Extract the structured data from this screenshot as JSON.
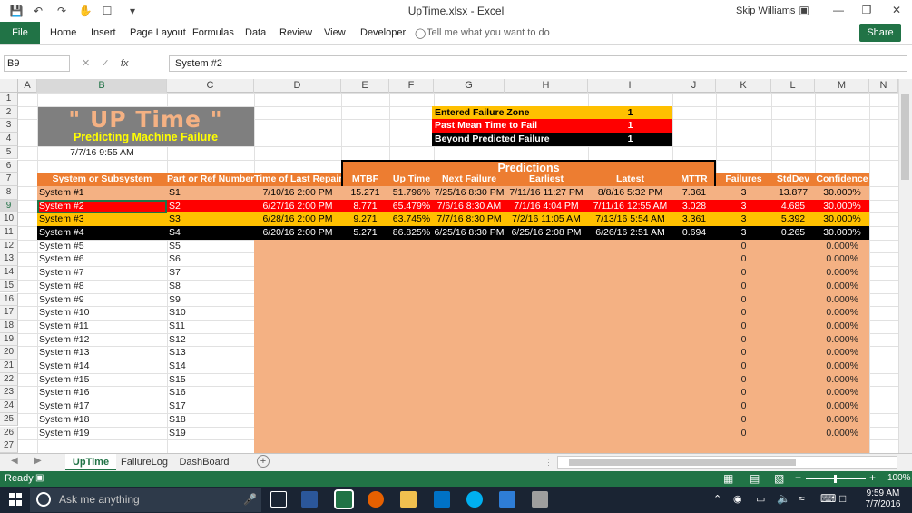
{
  "window": {
    "title": "UpTime.xlsx - Excel",
    "user": "Skip Williams"
  },
  "ribbon": {
    "file": "File",
    "tabs": [
      "Home",
      "Insert",
      "Page Layout",
      "Formulas",
      "Data",
      "Review",
      "View",
      "Developer"
    ],
    "tell_me": "Tell me what you want to do",
    "share": "Share"
  },
  "formula_bar": {
    "name_box": "B9",
    "formula": "System #2"
  },
  "columns": [
    "A",
    "B",
    "C",
    "D",
    "E",
    "F",
    "G",
    "H",
    "I",
    "J",
    "K",
    "L",
    "M",
    "N"
  ],
  "rows": [
    "1",
    "2",
    "3",
    "4",
    "5",
    "6",
    "7",
    "8",
    "9",
    "10",
    "11",
    "12",
    "13",
    "14",
    "15",
    "16",
    "17",
    "18",
    "19",
    "20",
    "21",
    "22",
    "23",
    "24",
    "25",
    "26",
    "27"
  ],
  "banner": {
    "title": "\" UP Time \"",
    "subtitle": "Predicting Machine Failure"
  },
  "date_cell": "7/7/16 9:55 AM",
  "legend": [
    {
      "label": "Entered Failure Zone",
      "value": "1",
      "color": "#ffc000"
    },
    {
      "label": "Past Mean Time to Fail",
      "value": "1",
      "color": "#ff0000"
    },
    {
      "label": "Beyond Predicted Failure",
      "value": "1",
      "color": "#000000"
    }
  ],
  "predictions_header": "Predictions",
  "headers": [
    "System or Subsystem",
    "Part or Ref  Number",
    "Time of Last Repair",
    "MTBF",
    "Up Time",
    "Next Failure",
    "Earliest",
    "Latest",
    "MTTR",
    "Failures",
    "StdDev",
    "Confidence"
  ],
  "data_rows": [
    {
      "system": "System #1",
      "part": "S1",
      "last": "7/10/16 2:00 PM",
      "mtbf": "15.271",
      "uptime": "51.796%",
      "next": "7/25/16 8:30 PM",
      "earliest": "7/11/16 11:27 PM",
      "latest": "8/8/16 5:32 PM",
      "mttr": "7.361",
      "failures": "3",
      "stddev": "13.877",
      "conf": "30.000%",
      "bg": "#f4b183",
      "fg": "#000000"
    },
    {
      "system": "System #2",
      "part": "S2",
      "last": "6/27/16 2:00 PM",
      "mtbf": "8.771",
      "uptime": "65.479%",
      "next": "7/6/16 8:30 AM",
      "earliest": "7/1/16 4:04 PM",
      "latest": "7/11/16 12:55 AM",
      "mttr": "3.028",
      "failures": "3",
      "stddev": "4.685",
      "conf": "30.000%",
      "bg": "#ff0000",
      "fg": "#ffffff"
    },
    {
      "system": "System #3",
      "part": "S3",
      "last": "6/28/16 2:00 PM",
      "mtbf": "9.271",
      "uptime": "63.745%",
      "next": "7/7/16 8:30 PM",
      "earliest": "7/2/16 11:05 AM",
      "latest": "7/13/16 5:54 AM",
      "mttr": "3.361",
      "failures": "3",
      "stddev": "5.392",
      "conf": "30.000%",
      "bg": "#ffc000",
      "fg": "#000000"
    },
    {
      "system": "System #4",
      "part": "S4",
      "last": "6/20/16 2:00 PM",
      "mtbf": "5.271",
      "uptime": "86.825%",
      "next": "6/25/16 8:30 PM",
      "earliest": "6/25/16 2:08 PM",
      "latest": "6/26/16 2:51 AM",
      "mttr": "0.694",
      "failures": "3",
      "stddev": "0.265",
      "conf": "30.000%",
      "bg": "#000000",
      "fg": "#ffffff"
    }
  ],
  "empty_rows": [
    {
      "system": "System #5",
      "part": "S5"
    },
    {
      "system": "System #6",
      "part": "S6"
    },
    {
      "system": "System #7",
      "part": "S7"
    },
    {
      "system": "System #8",
      "part": "S8"
    },
    {
      "system": "System #9",
      "part": "S9"
    },
    {
      "system": "System #10",
      "part": "S10"
    },
    {
      "system": "System #11",
      "part": "S11"
    },
    {
      "system": "System #12",
      "part": "S12"
    },
    {
      "system": "System #13",
      "part": "S13"
    },
    {
      "system": "System #14",
      "part": "S14"
    },
    {
      "system": "System #15",
      "part": "S15"
    },
    {
      "system": "System #16",
      "part": "S16"
    },
    {
      "system": "System #17",
      "part": "S17"
    },
    {
      "system": "System #18",
      "part": "S18"
    },
    {
      "system": "System #19",
      "part": "S19"
    }
  ],
  "empty_failures": "0",
  "empty_conf": "0.000%",
  "sheets": [
    "UpTime",
    "FailureLog",
    "DashBoard"
  ],
  "status": {
    "ready": "Ready",
    "zoom": "100%"
  },
  "taskbar": {
    "search": "Ask me anything",
    "time": "9:59 AM",
    "date": "7/7/2016"
  }
}
